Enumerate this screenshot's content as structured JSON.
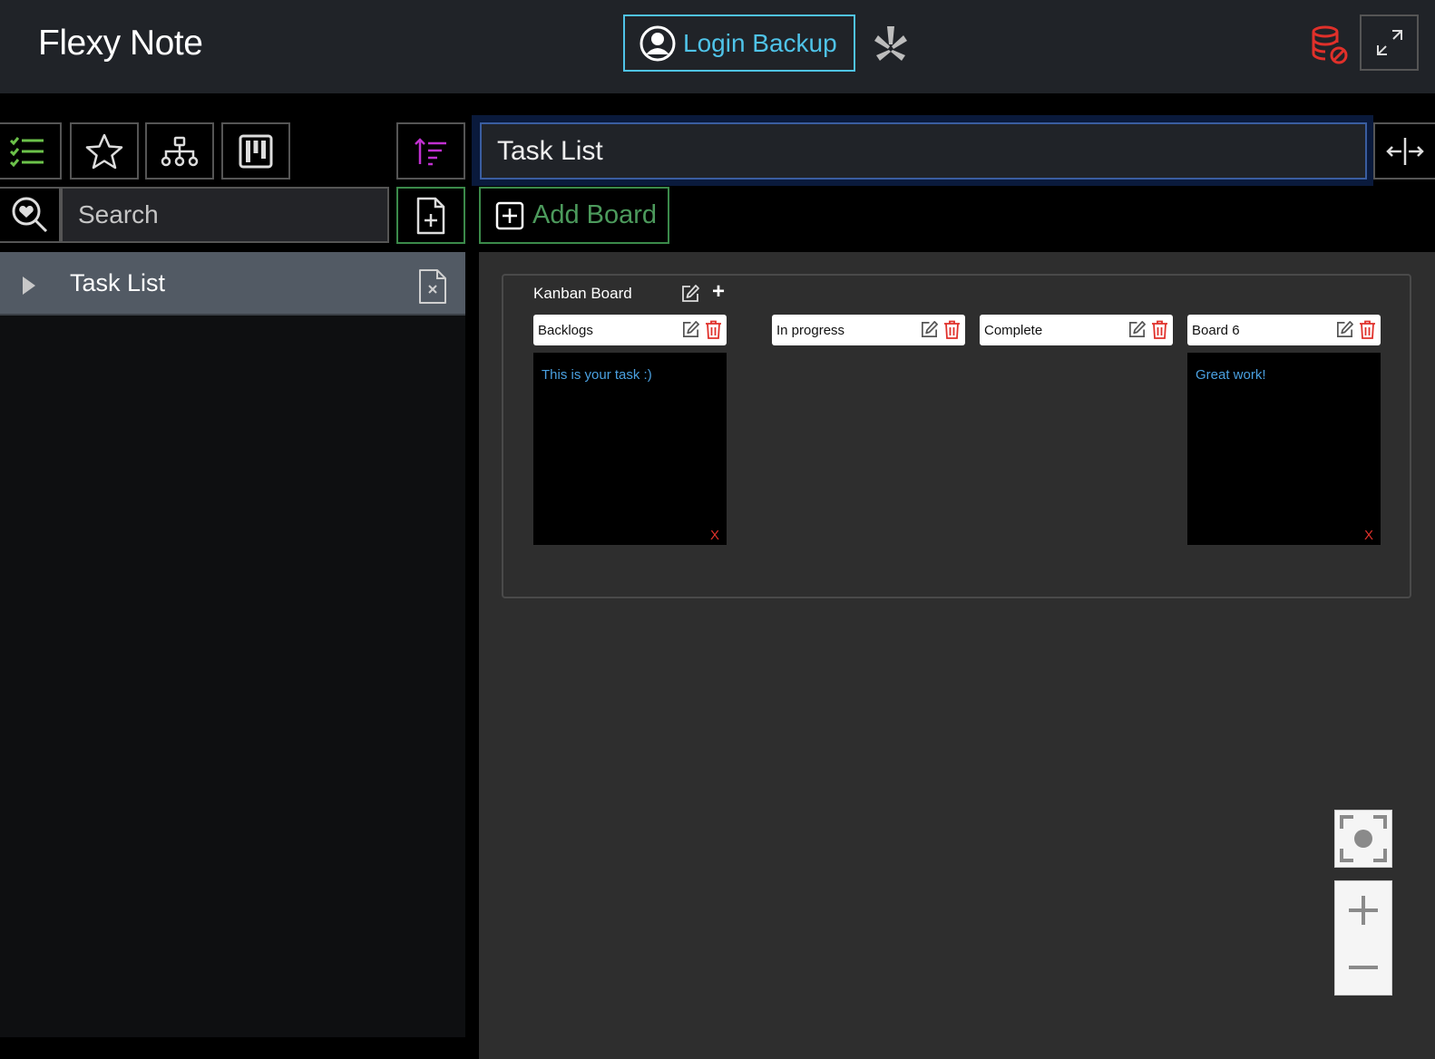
{
  "header": {
    "app_title": "Flexy Note",
    "login_label": "Login Backup"
  },
  "colors": {
    "accent_cyan": "#4fc3e8",
    "accent_green": "#4c9a5c",
    "accent_purple": "#c030d0",
    "danger_red": "#e0302a",
    "card_text_blue": "#4aa0e0"
  },
  "sidebar": {
    "search_placeholder": "Search",
    "notes": [
      {
        "title": "Task List"
      }
    ]
  },
  "toolbar": {
    "icons": [
      "checklist-icon",
      "star-icon",
      "hierarchy-icon",
      "kanban-icon"
    ]
  },
  "main": {
    "note_title": "Task List",
    "add_board_label": "Add Board",
    "kanban": {
      "title": "Kanban Board",
      "columns": [
        {
          "title": "Backlogs",
          "cards": [
            {
              "text": "This is your task :)",
              "delete_label": "X"
            }
          ]
        },
        {
          "title": "In progress",
          "cards": []
        },
        {
          "title": "Complete",
          "cards": []
        },
        {
          "title": "Board 6",
          "cards": [
            {
              "text": "Great work!",
              "delete_label": "X"
            }
          ]
        }
      ]
    }
  }
}
